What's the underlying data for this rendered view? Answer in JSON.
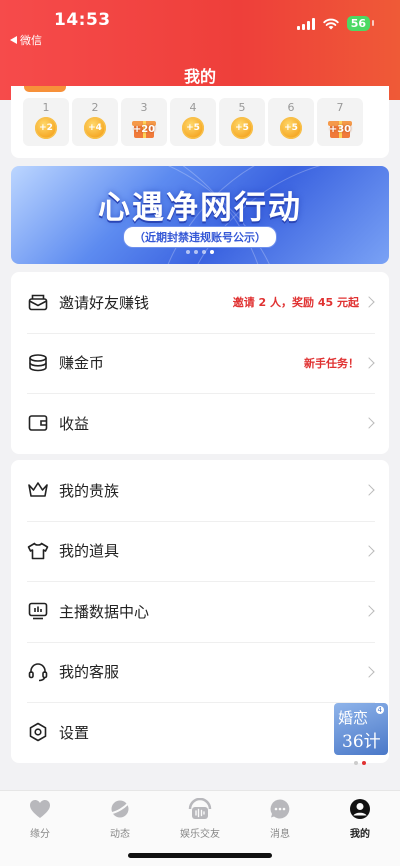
{
  "status": {
    "time": "14:53",
    "back_app": "微信",
    "battery": "56"
  },
  "header": {
    "title": "我的"
  },
  "checkin": {
    "days": [
      {
        "num": "1",
        "reward": "+2",
        "type": "coin"
      },
      {
        "num": "2",
        "reward": "+4",
        "type": "coin"
      },
      {
        "num": "3",
        "reward": "+20",
        "type": "gift"
      },
      {
        "num": "4",
        "reward": "+5",
        "type": "coin"
      },
      {
        "num": "5",
        "reward": "+5",
        "type": "coin"
      },
      {
        "num": "6",
        "reward": "+5",
        "type": "coin"
      },
      {
        "num": "7",
        "reward": "+30",
        "type": "gift"
      }
    ]
  },
  "banner": {
    "title": "心遇净网行动",
    "subtitle": "（近期封禁违规账号公示）",
    "active_dot": 3,
    "dot_count": 4
  },
  "menu1": {
    "invite": {
      "label": "邀请好友赚钱",
      "extra": "邀请 2 人，奖励 45 元起"
    },
    "earn": {
      "label": "赚金币",
      "extra": "新手任务！"
    },
    "income": {
      "label": "收益"
    }
  },
  "menu2": {
    "noble": {
      "label": "我的贵族"
    },
    "props": {
      "label": "我的道具"
    },
    "anchor": {
      "label": "主播数据中心"
    },
    "service": {
      "label": "我的客服"
    },
    "settings": {
      "label": "设置"
    }
  },
  "float_ad": {
    "line1": "婚恋",
    "line2": "36计",
    "badge": "4"
  },
  "tabbar": {
    "tabs": [
      {
        "label": "缘分",
        "icon": "heart-icon"
      },
      {
        "label": "动态",
        "icon": "planet-icon"
      },
      {
        "label": "娱乐交友",
        "icon": "voice-wave-icon"
      },
      {
        "label": "消息",
        "icon": "chat-bubble-icon"
      },
      {
        "label": "我的",
        "icon": "profile-icon",
        "active": true
      }
    ]
  },
  "colors": {
    "brand_red": "#f64b4b",
    "accent_red": "#e03232",
    "coin_gold": "#f5a623"
  }
}
